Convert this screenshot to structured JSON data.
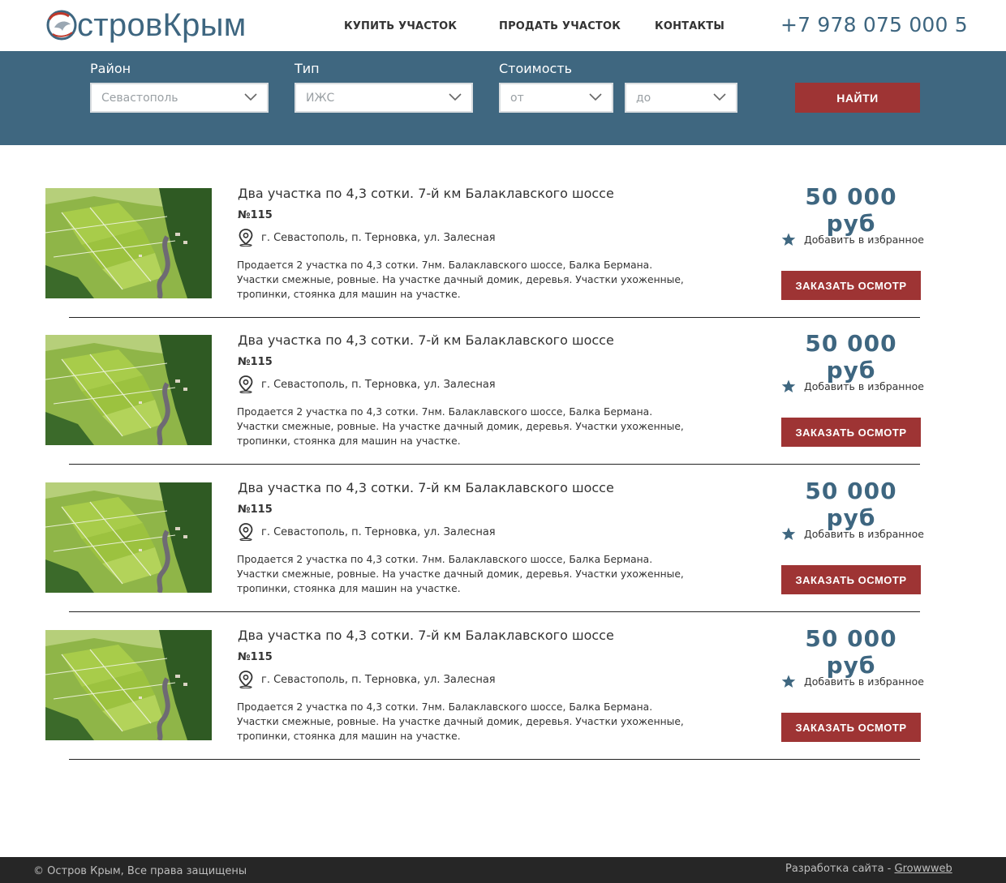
{
  "header": {
    "logo_text": "стровКрым",
    "nav": [
      "КУПИТЬ УЧАСТОК",
      "ПРОДАТЬ УЧАСТОК",
      "КОНТАКТЫ"
    ],
    "phone": "+7 978 075 000 5"
  },
  "filter": {
    "district_label": "Район",
    "district_value": "Севастополь",
    "type_label": "Тип",
    "type_value": "ИЖС",
    "price_label": "Стоимость",
    "price_from": "от",
    "price_to": "до",
    "search_button": "НАЙТИ"
  },
  "listings": [
    {
      "title": "Два участка по 4,3 сотки. 7-й км Балаклавского шоссе",
      "number": "№115",
      "address": "г. Севастополь, п. Терновка, ул. Залесная",
      "description": "Продается 2 участка по 4,3 сотки. 7нм. Балаклавского шоссе, Балка Бермана. Участки смежные, ровные. На участке дачный домик, деревья. Участки ухоженные, тропинки, стоянка для машин на участке.",
      "price": "50 000 руб",
      "favorite_label": "Добавить в избранное",
      "order_button": "ЗАКАЗАТЬ ОСМОТР"
    },
    {
      "title": "Два участка по 4,3 сотки. 7-й км Балаклавского шоссе",
      "number": "№115",
      "address": "г. Севастополь, п. Терновка, ул. Залесная",
      "description": "Продается 2 участка по 4,3 сотки. 7нм. Балаклавского шоссе, Балка Бермана. Участки смежные, ровные. На участке дачный домик, деревья. Участки ухоженные, тропинки, стоянка для машин на участке.",
      "price": "50 000 руб",
      "favorite_label": "Добавить в избранное",
      "order_button": "ЗАКАЗАТЬ ОСМОТР"
    },
    {
      "title": "Два участка по 4,3 сотки. 7-й км Балаклавского шоссе",
      "number": "№115",
      "address": "г. Севастополь, п. Терновка, ул. Залесная",
      "description": "Продается 2 участка по 4,3 сотки. 7нм. Балаклавского шоссе, Балка Бермана. Участки смежные, ровные. На участке дачный домик, деревья. Участки ухоженные, тропинки, стоянка для машин на участке.",
      "price": "50 000 руб",
      "favorite_label": "Добавить в избранное",
      "order_button": "ЗАКАЗАТЬ ОСМОТР"
    },
    {
      "title": "Два участка по 4,3 сотки. 7-й км Балаклавского шоссе",
      "number": "№115",
      "address": "г. Севастополь, п. Терновка, ул. Залесная",
      "description": "Продается 2 участка по 4,3 сотки. 7нм. Балаклавского шоссе, Балка Бермана. Участки смежные, ровные. На участке дачный домик, деревья. Участки ухоженные, тропинки, стоянка для машин на участке.",
      "price": "50 000 руб",
      "favorite_label": "Добавить в избранное",
      "order_button": "ЗАКАЗАТЬ ОСМОТР"
    }
  ],
  "footer": {
    "copyright": "© Остров Крым, Все права защищены",
    "dev_prefix": "Разработка сайта - ",
    "dev_link": "Growwweb"
  },
  "colors": {
    "brand_blue": "#3f6780",
    "accent_red": "#9e3434",
    "footer_bg": "#262626"
  }
}
